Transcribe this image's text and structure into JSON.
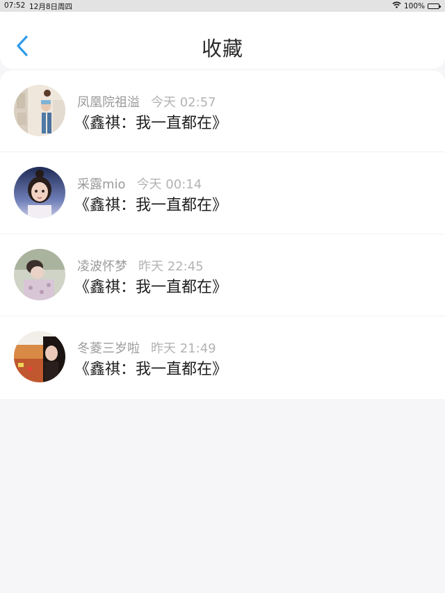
{
  "status_bar": {
    "time": "07:52",
    "date": "12月8日周四",
    "battery": "100%",
    "battery_level": 1.0,
    "icons": [
      "wifi-icon",
      "battery-icon"
    ]
  },
  "header": {
    "title": "收藏",
    "back_icon": "chevron-left-icon",
    "accent_color": "#2f9be8"
  },
  "favorites": [
    {
      "username": "凤凰院祖溢",
      "time": "今天 02:57",
      "content": "《鑫祺：我一直都在》"
    },
    {
      "username": "采露mio",
      "time": "今天 00:14",
      "content": "《鑫祺：我一直都在》"
    },
    {
      "username": "凌波怀梦",
      "time": "昨天 22:45",
      "content": "《鑫祺：我一直都在》"
    },
    {
      "username": "冬菱三岁啦",
      "time": "昨天 21:49",
      "content": "《鑫祺：我一直都在》"
    }
  ]
}
